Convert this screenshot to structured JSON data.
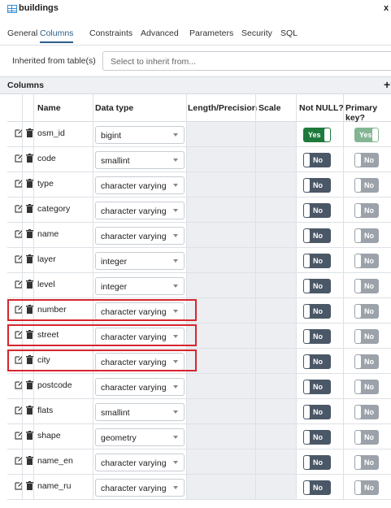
{
  "window": {
    "title": "buildings",
    "close_label": "x"
  },
  "tabs": [
    {
      "label": "General"
    },
    {
      "label": "Columns",
      "active": true
    },
    {
      "label": "Constraints"
    },
    {
      "label": "Advanced"
    },
    {
      "label": "Parameters"
    },
    {
      "label": "Security"
    },
    {
      "label": "SQL"
    }
  ],
  "inherit": {
    "label": "Inherited from table(s)",
    "placeholder": "Select to inherit from..."
  },
  "columns_panel": {
    "title": "Columns",
    "add_label": "+"
  },
  "grid": {
    "headers": {
      "name": "Name",
      "data_type": "Data type",
      "length": "Length/Precision",
      "scale": "Scale",
      "not_null": "Not NULL?",
      "primary_key": "Primary key?"
    },
    "rows": [
      {
        "name": "osm_id",
        "data_type": "bigint",
        "not_null": "Yes",
        "primary_key": "Yes"
      },
      {
        "name": "code",
        "data_type": "smallint",
        "not_null": "No",
        "primary_key": "No"
      },
      {
        "name": "type",
        "data_type": "character varying",
        "not_null": "No",
        "primary_key": "No"
      },
      {
        "name": "category",
        "data_type": "character varying",
        "not_null": "No",
        "primary_key": "No"
      },
      {
        "name": "name",
        "data_type": "character varying",
        "not_null": "No",
        "primary_key": "No"
      },
      {
        "name": "layer",
        "data_type": "integer",
        "not_null": "No",
        "primary_key": "No"
      },
      {
        "name": "level",
        "data_type": "integer",
        "not_null": "No",
        "primary_key": "No"
      },
      {
        "name": "number",
        "data_type": "character varying",
        "not_null": "No",
        "primary_key": "No"
      },
      {
        "name": "street",
        "data_type": "character varying",
        "not_null": "No",
        "primary_key": "No"
      },
      {
        "name": "city",
        "data_type": "character varying",
        "not_null": "No",
        "primary_key": "No"
      },
      {
        "name": "postcode",
        "data_type": "character varying",
        "not_null": "No",
        "primary_key": "No"
      },
      {
        "name": "flats",
        "data_type": "smallint",
        "not_null": "No",
        "primary_key": "No"
      },
      {
        "name": "shape",
        "data_type": "geometry",
        "not_null": "No",
        "primary_key": "No"
      },
      {
        "name": "name_en",
        "data_type": "character varying",
        "not_null": "No",
        "primary_key": "No"
      },
      {
        "name": "name_ru",
        "data_type": "character varying",
        "not_null": "No",
        "primary_key": "No"
      }
    ]
  },
  "colors": {
    "accent": "#2c5f8a",
    "toggle_off": "#4a5766",
    "toggle_on": "#1e7a3c",
    "highlight": "#d6262e"
  },
  "icons": {
    "table": "table-icon",
    "edit": "edit-icon",
    "delete": "trash-icon"
  }
}
